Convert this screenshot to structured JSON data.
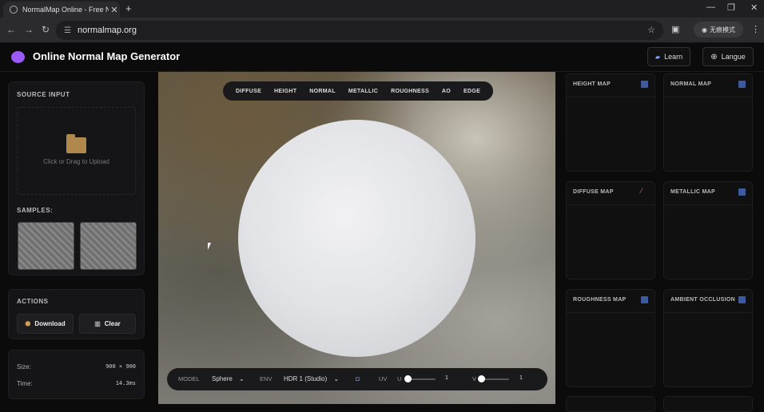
{
  "browser": {
    "tab_title": "NormalMap Online - Free N...",
    "url": "normalmap.org",
    "incognito_label": "无痕模式"
  },
  "header": {
    "title": "Online Normal Map Generator",
    "learn_label": "Learn",
    "language_label": "Langue"
  },
  "source": {
    "caption": "SOURCE INPUT",
    "drop_text": "Click or Drag to Upload"
  },
  "samples": {
    "caption": "SAMPLES:"
  },
  "actions": {
    "caption": "ACTIONS",
    "download_label": "Download",
    "clear_label": "Clear"
  },
  "stats": {
    "size_label": "Size:",
    "size_value": "900 × 900",
    "time_label": "Time:",
    "time_value": "14.3ms"
  },
  "view_tabs": [
    "DIFFUSE",
    "HEIGHT",
    "NORMAL",
    "METALLIC",
    "ROUGHNESS",
    "AO",
    "EDGE"
  ],
  "controls": {
    "model_label": "MODEL",
    "model_value": "Sphere",
    "env_label": "ENV",
    "env_value": "HDR 1 (Studio)",
    "uv_label": "UV",
    "u_label": "U",
    "u_value": "1",
    "v_label": "V",
    "v_value": "1"
  },
  "maps": [
    {
      "title": "HEIGHT MAP",
      "icon": "square-icon"
    },
    {
      "title": "NORMAL MAP",
      "icon": "square-icon"
    },
    {
      "title": "DIFFUSE MAP",
      "icon": "brush-icon"
    },
    {
      "title": "METALLIC MAP",
      "icon": "square-icon"
    },
    {
      "title": "ROUGHNESS MAP",
      "icon": "square-icon"
    },
    {
      "title": "AMBIENT OCCLUSION",
      "icon": "square-icon"
    }
  ],
  "colors": {
    "accent": "#9b59f6",
    "map_icon": "#3d5b9c"
  }
}
